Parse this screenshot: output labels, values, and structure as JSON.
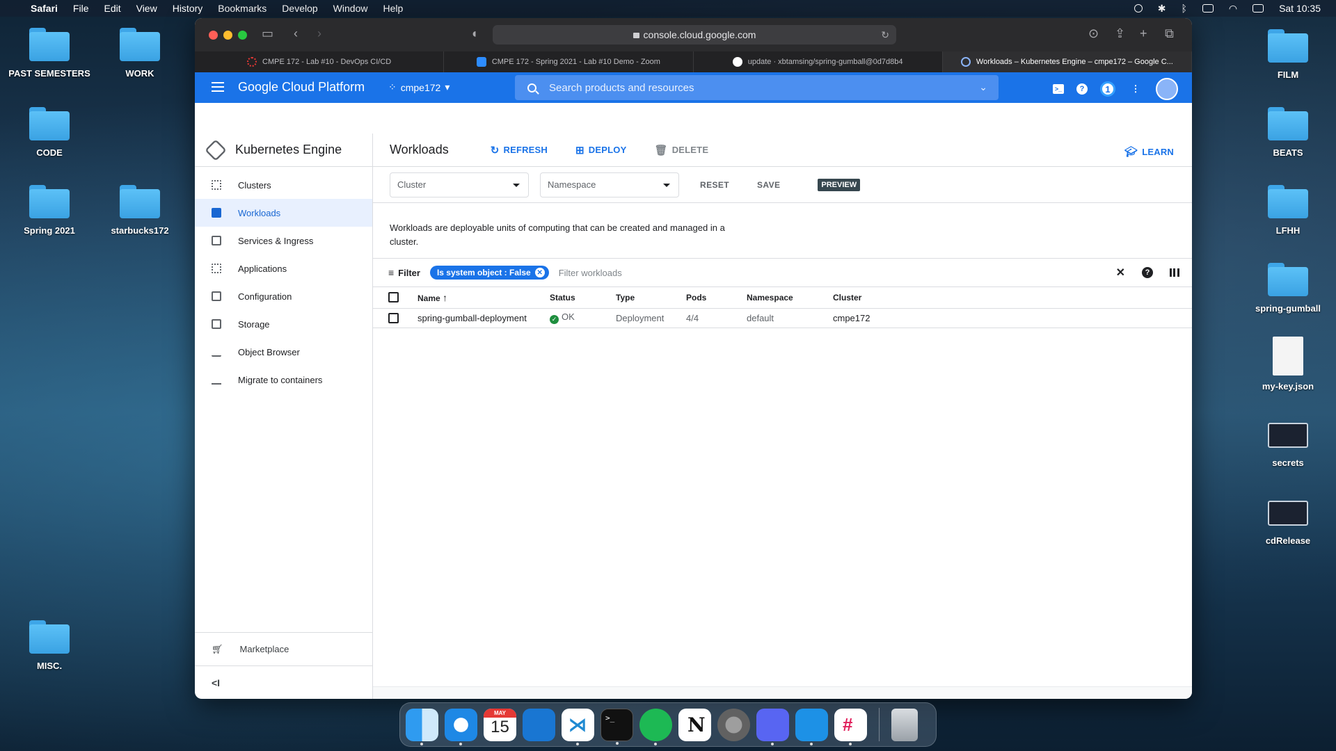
{
  "menubar": {
    "app": "Safari",
    "items": [
      "File",
      "Edit",
      "View",
      "History",
      "Bookmarks",
      "Develop",
      "Window",
      "Help"
    ],
    "clock": "Sat 10:35"
  },
  "desktop": {
    "left": [
      {
        "label": "PAST SEMESTERS"
      },
      {
        "label": "WORK"
      },
      {
        "label": "CODE"
      },
      {
        "label": "Spring 2021"
      },
      {
        "label": "starbucks172"
      },
      {
        "label": "MISC."
      }
    ],
    "right": [
      {
        "label": "FILM"
      },
      {
        "label": "BEATS"
      },
      {
        "label": "LFHH"
      },
      {
        "label": "spring-gumball"
      },
      {
        "label": "my-key.json"
      },
      {
        "label": "secrets"
      },
      {
        "label": "cdRelease"
      }
    ]
  },
  "browser": {
    "url": "console.cloud.google.com",
    "tabs": [
      {
        "label": "CMPE 172 - Lab #10 - DevOps CI/CD",
        "color": "#e53935"
      },
      {
        "label": "CMPE 172 - Spring 2021 - Lab #10 Demo - Zoom",
        "color": "#2d8cff"
      },
      {
        "label": "update · xbtamsing/spring-gumball@0d7d8b4",
        "color": "#ffffff"
      },
      {
        "label": "Workloads – Kubernetes Engine – cmpe172 – Google C...",
        "color": "#4285f4"
      }
    ]
  },
  "gcp": {
    "title": "Google Cloud Platform",
    "project": "cmpe172",
    "search_placeholder": "Search products and resources",
    "notification_count": "1"
  },
  "sidebar": {
    "product": "Kubernetes Engine",
    "items": [
      {
        "label": "Clusters"
      },
      {
        "label": "Workloads"
      },
      {
        "label": "Services & Ingress"
      },
      {
        "label": "Applications"
      },
      {
        "label": "Configuration"
      },
      {
        "label": "Storage"
      },
      {
        "label": "Object Browser"
      },
      {
        "label": "Migrate to containers"
      }
    ],
    "marketplace": "Marketplace",
    "collapse": "<I"
  },
  "page": {
    "title": "Workloads",
    "refresh": "REFRESH",
    "deploy": "DEPLOY",
    "delete": "DELETE",
    "learn": "LEARN",
    "cluster_select": "Cluster",
    "namespace_select": "Namespace",
    "reset": "RESET",
    "save": "SAVE",
    "preview": "PREVIEW",
    "description": "Workloads are deployable units of computing that can be created and managed in a cluster.",
    "filter_label": "Filter",
    "filter_chip": "Is system object : False",
    "filter_placeholder": "Filter workloads"
  },
  "table": {
    "headers": {
      "name": "Name",
      "status": "Status",
      "type": "Type",
      "pods": "Pods",
      "namespace": "Namespace",
      "cluster": "Cluster"
    },
    "rows": [
      {
        "name": "spring-gumball-deployment",
        "status": "OK",
        "type": "Deployment",
        "pods": "4/4",
        "namespace": "default",
        "cluster": "cmpe172"
      }
    ]
  },
  "dock": {
    "calendar_month": "MAY",
    "calendar_day": "15",
    "apps": [
      "finder-icon",
      "safari-icon",
      "calendar-icon",
      "xcode-icon",
      "vscode-icon",
      "terminal-icon",
      "spotify-icon",
      "notion-icon",
      "settings-icon",
      "discord-icon",
      "docker-icon",
      "slack-icon",
      "trash-icon"
    ]
  }
}
